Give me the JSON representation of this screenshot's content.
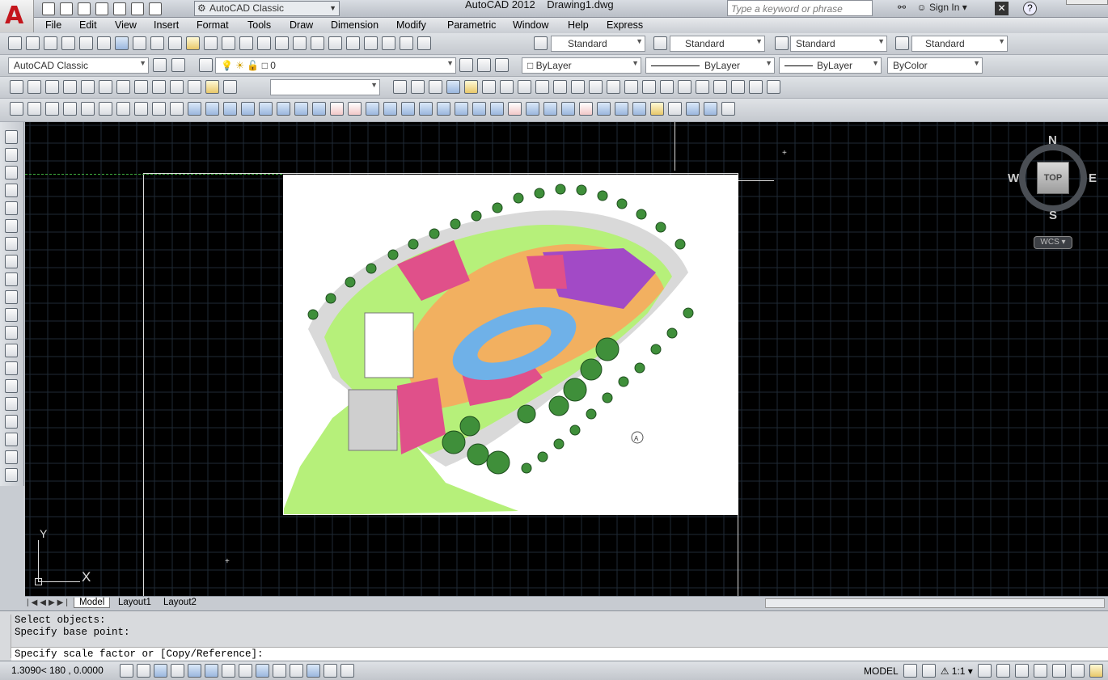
{
  "app": {
    "name": "AutoCAD 2012",
    "document": "Drawing1.dwg",
    "workspace": "AutoCAD Classic"
  },
  "search": {
    "placeholder": "Type a keyword or phrase"
  },
  "user": {
    "signin": "Sign In"
  },
  "menu": [
    "File",
    "Edit",
    "View",
    "Insert",
    "Format",
    "Tools",
    "Draw",
    "Dimension",
    "Modify",
    "Parametric",
    "Window",
    "Help",
    "Express"
  ],
  "styles": {
    "text_style": "Standard",
    "dim_style": "Standard",
    "table_style": "Standard",
    "mleader_style": "Standard"
  },
  "layers": {
    "workspace_combo": "AutoCAD Classic",
    "current_layer": "0",
    "color": "ByLayer",
    "linetype": "ByLayer",
    "lineweight": "ByLayer",
    "plotstyle": "ByColor"
  },
  "viewcube": {
    "north": "N",
    "south": "S",
    "east": "E",
    "west": "W",
    "face": "TOP",
    "ucs": "WCS"
  },
  "ucs_icon": {
    "x": "X",
    "y": "Y"
  },
  "layout_tabs": [
    "Model",
    "Layout1",
    "Layout2"
  ],
  "command": {
    "history": [
      "Select objects:",
      "Specify base point:"
    ],
    "prompt": "Specify scale factor or [Copy/Reference]:"
  },
  "status": {
    "coordinates": "1.3090< 180   , 0.0000",
    "space": "MODEL",
    "annotation_scale": "1:1"
  },
  "colors": {
    "canvas": "#000000",
    "grid": "#1f2a36",
    "plan_pink": "#e0508a",
    "plan_orange": "#f2b060",
    "plan_purple": "#a24ac6",
    "plan_blue": "#6fb1e8",
    "plan_green": "#b6f07a",
    "tree_green": "#3f8f3a"
  },
  "icons": [
    "new-icon",
    "open-icon",
    "save-icon",
    "print-icon",
    "undo-icon",
    "redo-icon",
    "binoculars-icon",
    "user-icon",
    "help-icon",
    "pan-icon",
    "zoom-icon",
    "layer-icon",
    "gear-icon"
  ]
}
